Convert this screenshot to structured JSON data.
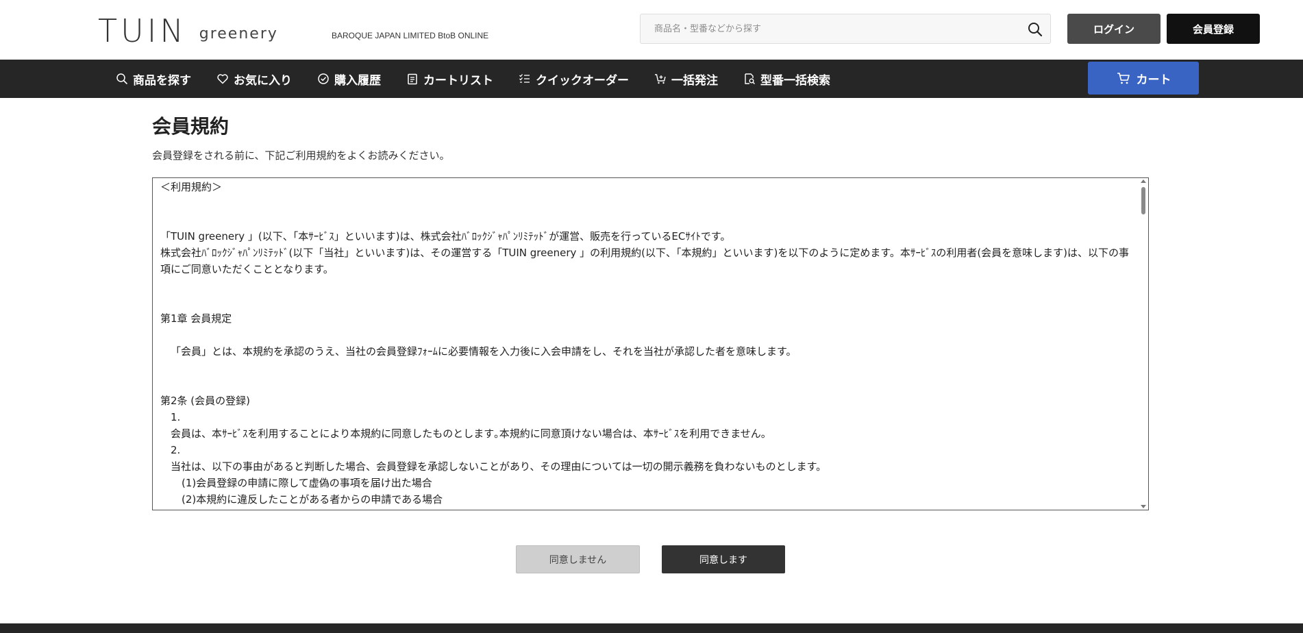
{
  "header": {
    "logo_main": "TUIN",
    "logo_sub": "greenery",
    "tagline": "BAROQUE JAPAN LIMITED BtoB ONLINE",
    "search_placeholder": "商品名・型番などから探す",
    "login_label": "ログイン",
    "register_label": "会員登録"
  },
  "nav": {
    "items": [
      {
        "label": "商品を探す",
        "icon": "search-icon"
      },
      {
        "label": "お気に入り",
        "icon": "heart-icon"
      },
      {
        "label": "購入履歴",
        "icon": "history-icon"
      },
      {
        "label": "カートリスト",
        "icon": "clipboard-icon"
      },
      {
        "label": "クイックオーダー",
        "icon": "checklist-icon"
      },
      {
        "label": "一括発注",
        "icon": "cart-plus-icon"
      },
      {
        "label": "型番一括検索",
        "icon": "document-search-icon"
      }
    ],
    "cart_label": "カート"
  },
  "main": {
    "title": "会員規約",
    "intro": "会員登録をされる前に、下記ご利用規約をよくお読みください。",
    "terms": [
      "＜利用規約＞",
      "",
      "",
      "「TUIN greenery 」(以下、「本ｻｰﾋﾞｽ」といいます)は、株式会社ﾊﾞﾛｯｸｼﾞｬﾊﾟﾝﾘﾐﾃｯﾄﾞが運営、販売を行っているECｻｲﾄです。",
      "株式会社ﾊﾞﾛｯｸｼﾞｬﾊﾟﾝﾘﾐﾃｯﾄﾞ(以下「当社」といいます)は、その運営する「TUIN greenery 」の利用規約(以下、「本規約」といいます)を以下のように定めます。本ｻｰﾋﾞｽの利用者(会員を意味します)は、以下の事項にご同意いただくこととなります。",
      "",
      "",
      "第1章 会員規定",
      "",
      "「会員」とは、本規約を承認のうえ、当社の会員登録ﾌｫｰﾑに必要情報を入力後に入会申請をし、それを当社が承認した者を意味します。",
      "",
      "",
      "第2条 (会員の登録)",
      "1.",
      "会員は、本ｻｰﾋﾞｽを利用することにより本規約に同意したものとします｡本規約に同意頂けない場合は、本ｻｰﾋﾞｽを利用できません。",
      "2.",
      "当社は、以下の事由があると判断した場合、会員登録を承認しないことがあり、その理由については一切の開示義務を負わないものとします。",
      "(1)会員登録の申請に際して虚偽の事項を届け出た場合",
      "(2)本規約に違反したことがある者からの申請である場合"
    ],
    "disagree_label": "同意しません",
    "agree_label": "同意します"
  }
}
